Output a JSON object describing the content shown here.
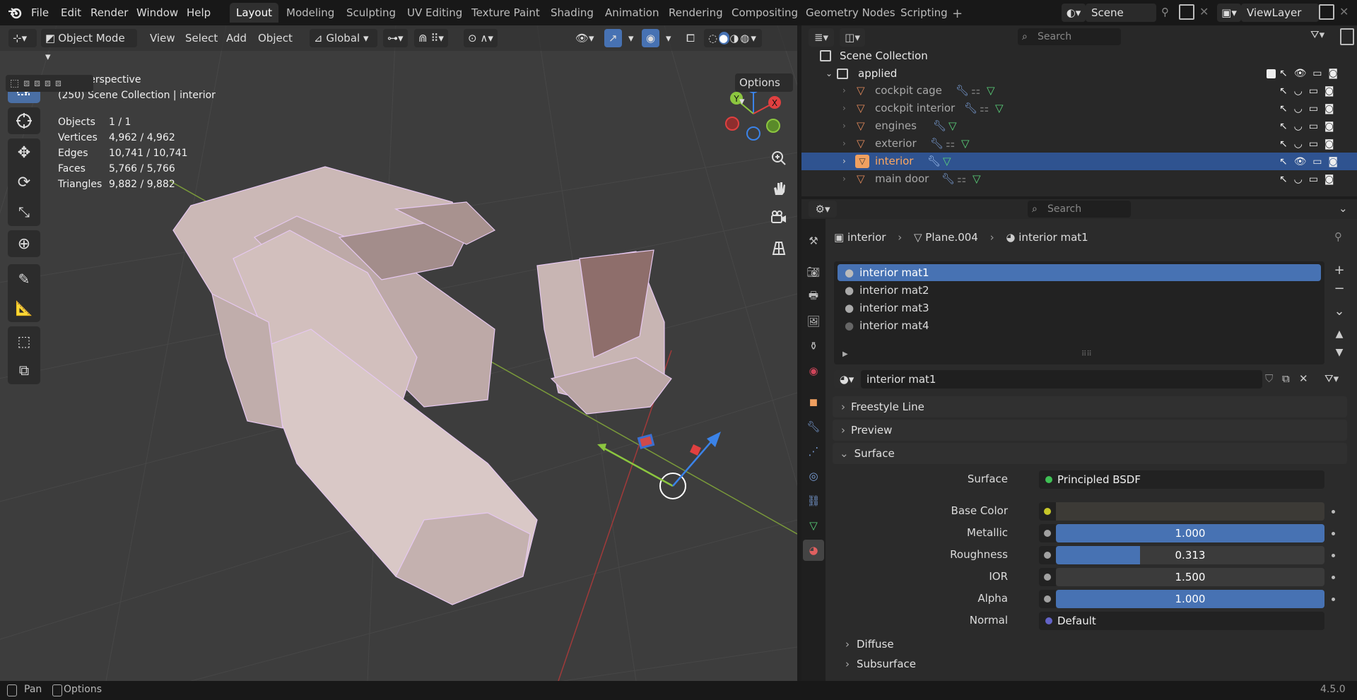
{
  "menu": {
    "file": "File",
    "edit": "Edit",
    "render": "Render",
    "window": "Window",
    "help": "Help"
  },
  "workspaces": [
    "Layout",
    "Modeling",
    "Sculpting",
    "UV Editing",
    "Texture Paint",
    "Shading",
    "Animation",
    "Rendering",
    "Compositing",
    "Geometry Nodes",
    "Scripting"
  ],
  "scene": {
    "name": "Scene",
    "view_layer": "ViewLayer"
  },
  "viewport": {
    "mode": "Object Mode",
    "view": "View",
    "select": "Select",
    "add": "Add",
    "object": "Object",
    "orientation": "Global",
    "options": "Options",
    "perspective": "User Perspective",
    "collection_info": "(250) Scene Collection | interior",
    "stats": [
      {
        "label": "Objects",
        "value": "1 / 1"
      },
      {
        "label": "Vertices",
        "value": "4,962 / 4,962"
      },
      {
        "label": "Edges",
        "value": "10,741 / 10,741"
      },
      {
        "label": "Faces",
        "value": "5,766 / 5,766"
      },
      {
        "label": "Triangles",
        "value": "9,882 / 9,882"
      }
    ],
    "gizmo": {
      "x": "X",
      "y": "Y",
      "z": "Z"
    }
  },
  "outliner": {
    "search_placeholder": "Search",
    "root": "Scene Collection",
    "collection": "applied",
    "items": [
      {
        "name": "cockpit cage"
      },
      {
        "name": "cockpit interior"
      },
      {
        "name": "engines"
      },
      {
        "name": "exterior"
      },
      {
        "name": "interior"
      },
      {
        "name": "main door"
      }
    ]
  },
  "properties": {
    "search_placeholder": "Search",
    "breadcrumb": {
      "object": "interior",
      "mesh": "Plane.004",
      "material": "interior mat1"
    },
    "slots": [
      "interior mat1",
      "interior mat2",
      "interior mat3",
      "interior mat4"
    ],
    "material_name": "interior mat1",
    "sections": {
      "freestyle": "Freestyle Line",
      "preview": "Preview",
      "surface": "Surface",
      "diffuse": "Diffuse",
      "subsurface": "Subsurface"
    },
    "surface_label": "Surface",
    "surface_value": "Principled BSDF",
    "fields": [
      {
        "label": "Base Color",
        "value": "",
        "fill": 0,
        "sock": "#c7c729"
      },
      {
        "label": "Metallic",
        "value": "1.000",
        "fill": 1.0,
        "sock": "#a1a1a1"
      },
      {
        "label": "Roughness",
        "value": "0.313",
        "fill": 0.313,
        "sock": "#a1a1a1"
      },
      {
        "label": "IOR",
        "value": "1.500",
        "fill": 0,
        "sock": "#a1a1a1"
      },
      {
        "label": "Alpha",
        "value": "1.000",
        "fill": 1.0,
        "sock": "#a1a1a1"
      }
    ],
    "normal_label": "Normal",
    "normal_value": "Default"
  },
  "statusbar": {
    "pan": "Pan",
    "options": "Options",
    "version": "4.5.0"
  },
  "colors": {
    "accent": "#4772b3",
    "selected_row": "#2f5390",
    "background": "#1d1d1d"
  }
}
